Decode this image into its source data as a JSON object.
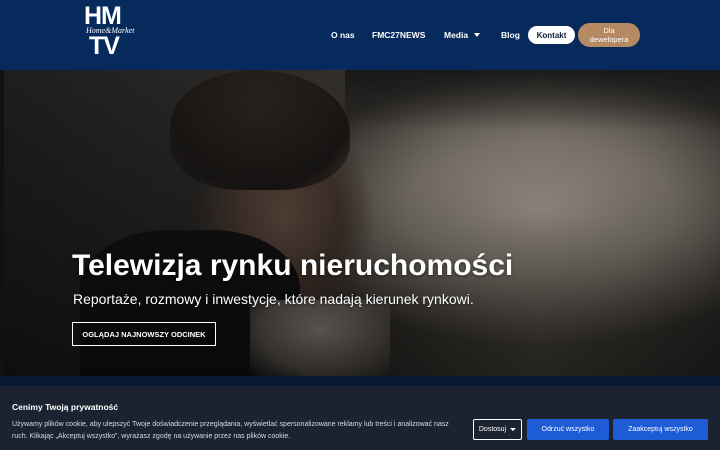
{
  "header": {
    "logo": {
      "line1": "HM",
      "tagline": "Home&Market",
      "line2": "TV"
    },
    "nav": [
      {
        "label": "O nas"
      },
      {
        "label": "FMC27NEWS"
      },
      {
        "label": "Media",
        "has_dropdown": true
      },
      {
        "label": "Blog"
      }
    ],
    "kontakt_label": "Kontakt",
    "developer_label": "Dla dewelopera"
  },
  "hero": {
    "title": "Telewizja rynku nieruchomości",
    "subtitle": "Reportaże, rozmowy i inwestycje, które nadają kierunek rynkowi.",
    "cta_label": "OGLĄDAJ NAJNOWSZY ODCINEK"
  },
  "cookie": {
    "title": "Cenimy Twoją prywatność",
    "text": "Używamy plików cookie, aby ulepszyć Twoje doświadczenie przeglądania, wyświetlać spersonalizowane reklamy lub treści i analizować nasz ruch. Klikając „Akceptuj wszystko”, wyrażasz zgodę na używanie przez nas plików cookie.",
    "customize_label": "Dostosuj",
    "reject_label": "Odrzuć wszystko",
    "accept_label": "Zaakceptuj wszystko"
  },
  "colors": {
    "header_bg": "#062a5c",
    "developer_button": "#b58a62",
    "cookie_bg": "#1c2330",
    "cookie_button": "#1e5bd6"
  }
}
